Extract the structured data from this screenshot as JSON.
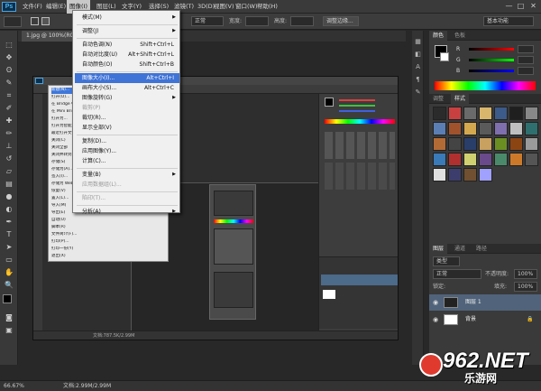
{
  "app": {
    "logo": "Ps",
    "doc_tab": "1.jpg @ 100%(RGB..."
  },
  "menubar": {
    "items": [
      "文件(F)",
      "编辑(E)",
      "图像(I)",
      "图层(L)",
      "文字(Y)",
      "选择(S)",
      "滤镜(T)",
      "3D(D)",
      "视图(V)",
      "窗口(W)",
      "帮助(H)"
    ],
    "active_index": 2,
    "window_buttons": [
      "—",
      "□",
      "✕"
    ]
  },
  "options": {
    "mode_value": "正常",
    "width_label": "宽度:",
    "height_label": "高度:",
    "adjust_btn": "调整边缘...",
    "workspace_value": "基本功能"
  },
  "image_menu": {
    "items": [
      {
        "label": "模式(M)",
        "shortcut": "",
        "submenu": true,
        "disabled": false,
        "highlight": false,
        "sep_after": true
      },
      {
        "label": "调整(J)",
        "shortcut": "",
        "submenu": true,
        "disabled": false,
        "highlight": false,
        "sep_after": true
      },
      {
        "label": "自动色调(N)",
        "shortcut": "Shift+Ctrl+L",
        "submenu": false,
        "disabled": false,
        "highlight": false,
        "sep_after": false
      },
      {
        "label": "自动对比度(U)",
        "shortcut": "Alt+Shift+Ctrl+L",
        "submenu": false,
        "disabled": false,
        "highlight": false,
        "sep_after": false
      },
      {
        "label": "自动颜色(O)",
        "shortcut": "Shift+Ctrl+B",
        "submenu": false,
        "disabled": false,
        "highlight": false,
        "sep_after": true
      },
      {
        "label": "图像大小(I)...",
        "shortcut": "Alt+Ctrl+I",
        "submenu": false,
        "disabled": false,
        "highlight": true,
        "sep_after": false
      },
      {
        "label": "画布大小(S)...",
        "shortcut": "Alt+Ctrl+C",
        "submenu": false,
        "disabled": false,
        "highlight": false,
        "sep_after": false
      },
      {
        "label": "图像旋转(G)",
        "shortcut": "",
        "submenu": true,
        "disabled": false,
        "highlight": false,
        "sep_after": false
      },
      {
        "label": "裁剪(P)",
        "shortcut": "",
        "submenu": false,
        "disabled": true,
        "highlight": false,
        "sep_after": false
      },
      {
        "label": "裁切(R)...",
        "shortcut": "",
        "submenu": false,
        "disabled": false,
        "highlight": false,
        "sep_after": false
      },
      {
        "label": "显示全部(V)",
        "shortcut": "",
        "submenu": false,
        "disabled": false,
        "highlight": false,
        "sep_after": true
      },
      {
        "label": "复制(D)...",
        "shortcut": "",
        "submenu": false,
        "disabled": false,
        "highlight": false,
        "sep_after": false
      },
      {
        "label": "应用图像(Y)...",
        "shortcut": "",
        "submenu": false,
        "disabled": false,
        "highlight": false,
        "sep_after": false
      },
      {
        "label": "计算(C)...",
        "shortcut": "",
        "submenu": false,
        "disabled": false,
        "highlight": false,
        "sep_after": true
      },
      {
        "label": "变量(B)",
        "shortcut": "",
        "submenu": true,
        "disabled": false,
        "highlight": false,
        "sep_after": false
      },
      {
        "label": "应用数据组(L)...",
        "shortcut": "",
        "submenu": false,
        "disabled": true,
        "highlight": false,
        "sep_after": true
      },
      {
        "label": "陷印(T)...",
        "shortcut": "",
        "submenu": false,
        "disabled": true,
        "highlight": false,
        "sep_after": true
      },
      {
        "label": "分析(A)",
        "shortcut": "",
        "submenu": true,
        "disabled": false,
        "highlight": false,
        "sep_after": false
      }
    ]
  },
  "nested": {
    "menu_items": [
      "新建(N)...",
      "打开(O)...",
      "在 Bridge 中浏览(B)...",
      "在 Mini Bridge 中浏览(G)...",
      "打开为...",
      "打开为智能对象...",
      "最近打开文件(T)",
      "关闭(C)",
      "关闭全部",
      "关闭并转到 Bridge...",
      "存储(S)",
      "存储为(A)...",
      "签入(I)...",
      "存储为 Web 所用格式...",
      "恢复(V)",
      "置入(L)...",
      "导入(M)",
      "导出(E)",
      "自动(U)",
      "脚本(R)",
      "文件简介(F)...",
      "打印(P)...",
      "打印一份(Y)",
      "退出(X)"
    ],
    "highlight_index": 0,
    "status_text": "文档:787.5K/2.99M"
  },
  "panels": {
    "color_tabs": [
      "颜色",
      "色板"
    ],
    "style_tabs": [
      "调整",
      "样式"
    ],
    "layer_tabs": [
      "图层",
      "通道",
      "路径"
    ],
    "color_labels": [
      "R",
      "G",
      "B"
    ],
    "kind_label": "类型",
    "blend_mode": "正常",
    "opacity_label": "不透明度:",
    "opacity_value": "100%",
    "lock_label": "锁定:",
    "fill_label": "填充:",
    "fill_value": "100%",
    "layers": [
      {
        "name": "图层 1",
        "selected": true,
        "has_lock": false
      },
      {
        "name": "背景",
        "selected": false,
        "has_lock": true
      }
    ]
  },
  "status": {
    "zoom": "66.67%",
    "doc": "文档:2.99M/2.99M"
  },
  "watermark": {
    "text": "962.NET",
    "sub": "乐游网"
  }
}
